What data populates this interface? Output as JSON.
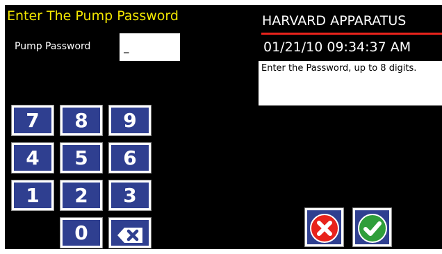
{
  "screen": {
    "title": "Enter The Pump Password",
    "password_label": "Pump Password",
    "password_value": "_"
  },
  "header": {
    "brand": "HARVARD APPARATUS",
    "datetime": "01/21/10 09:34:37 AM"
  },
  "message": "Enter the Password, up to 8 digits.",
  "keypad": {
    "k7": "7",
    "k8": "8",
    "k9": "9",
    "k4": "4",
    "k5": "5",
    "k6": "6",
    "k1": "1",
    "k2": "2",
    "k3": "3",
    "k0": "0",
    "backspace_icon": "backspace-icon"
  },
  "actions": {
    "cancel_icon": "cancel-x-icon",
    "confirm_icon": "confirm-check-icon"
  },
  "colors": {
    "background": "#000000",
    "title": "#f2e600",
    "brand_rule": "#e8231c",
    "key_fill": "#2f3f90",
    "cancel_red": "#e8231c",
    "confirm_green": "#2f9e3a"
  }
}
